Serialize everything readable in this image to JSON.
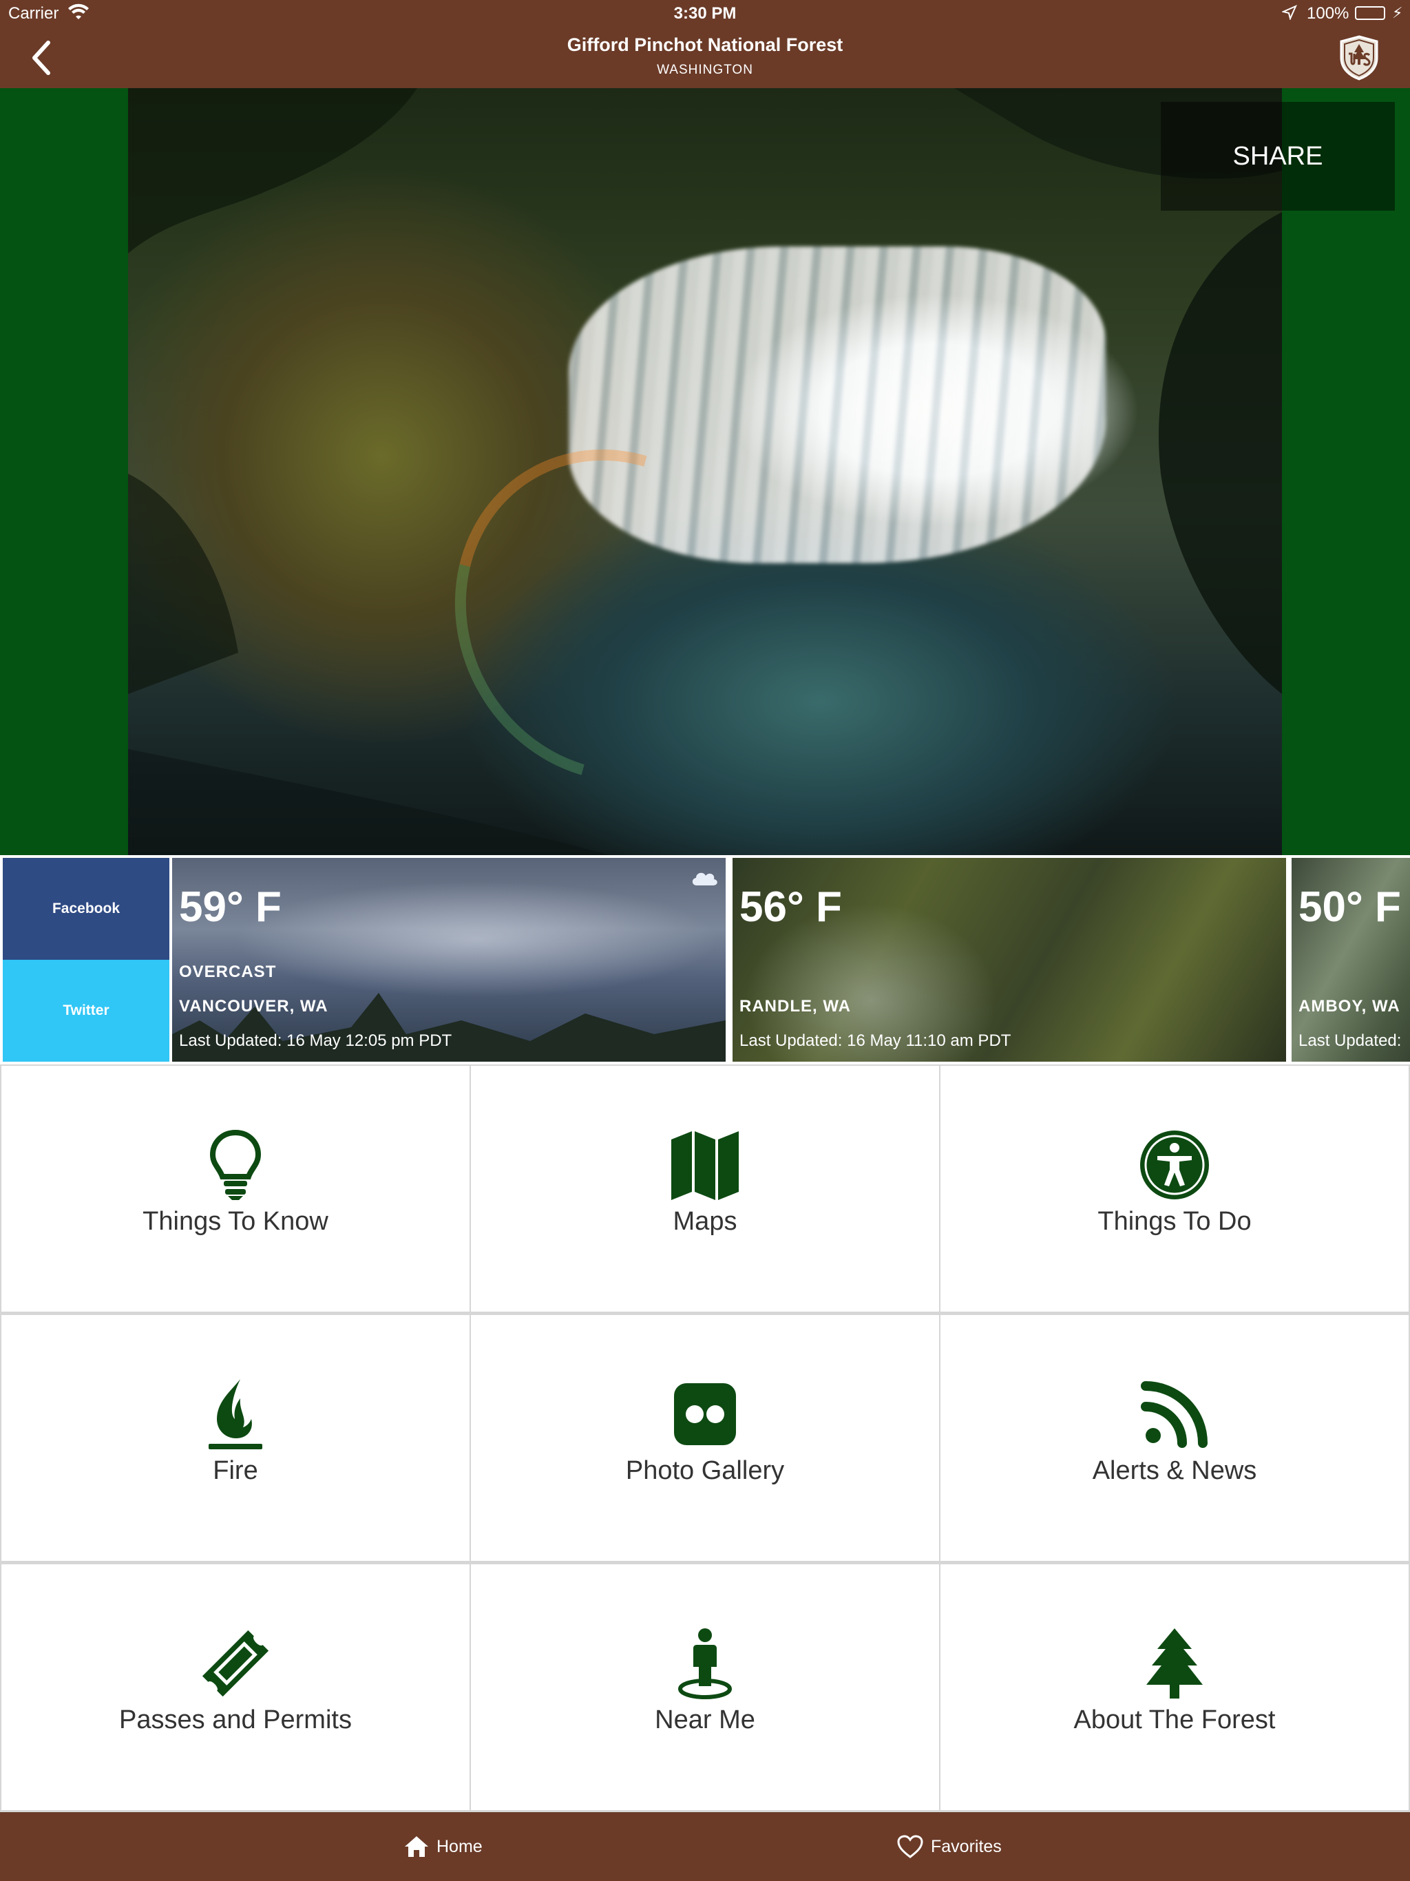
{
  "status_bar": {
    "carrier": "Carrier",
    "time": "3:30 PM",
    "battery": "100%"
  },
  "nav": {
    "title": "Gifford Pinchot National Forest",
    "subtitle": "WASHINGTON",
    "back_icon": "chevron-left-icon",
    "logo": "forest-service-shield"
  },
  "hero": {
    "share_label": "SHARE"
  },
  "social": {
    "facebook_label": "Facebook",
    "twitter_label": "Twitter",
    "facebook_color": "#2f4b84",
    "twitter_color": "#30c6f6"
  },
  "weather": [
    {
      "temp": "59° F",
      "condition": "OVERCAST",
      "city": "VANCOUVER, WA",
      "updated": "Last Updated: 16 May 12:05 pm PDT",
      "icon": "cloud-icon"
    },
    {
      "temp": "56° F",
      "condition": "",
      "city": "RANDLE, WA",
      "updated": "Last Updated: 16 May 11:10 am PDT"
    },
    {
      "temp": "50° F",
      "condition": "",
      "city": "AMBOY, WA",
      "updated": "Last Updated:"
    }
  ],
  "menu": [
    {
      "label": "Things To Know",
      "icon": "lightbulb-icon"
    },
    {
      "label": "Maps",
      "icon": "map-icon"
    },
    {
      "label": "Things To Do",
      "icon": "accessibility-icon"
    },
    {
      "label": "Fire",
      "icon": "fire-icon"
    },
    {
      "label": "Photo Gallery",
      "icon": "flickr-icon"
    },
    {
      "label": "Alerts  & News",
      "icon": "rss-icon"
    },
    {
      "label": "Passes and Permits",
      "icon": "ticket-icon"
    },
    {
      "label": "Near Me",
      "icon": "person-pin-icon"
    },
    {
      "label": "About The Forest",
      "icon": "tree-icon"
    }
  ],
  "tabs": {
    "home_label": "Home",
    "favorites_label": "Favorites"
  },
  "colors": {
    "bar_brown": "#6b3b28",
    "forest_green": "#045312",
    "icon_green": "#0d4a12"
  }
}
